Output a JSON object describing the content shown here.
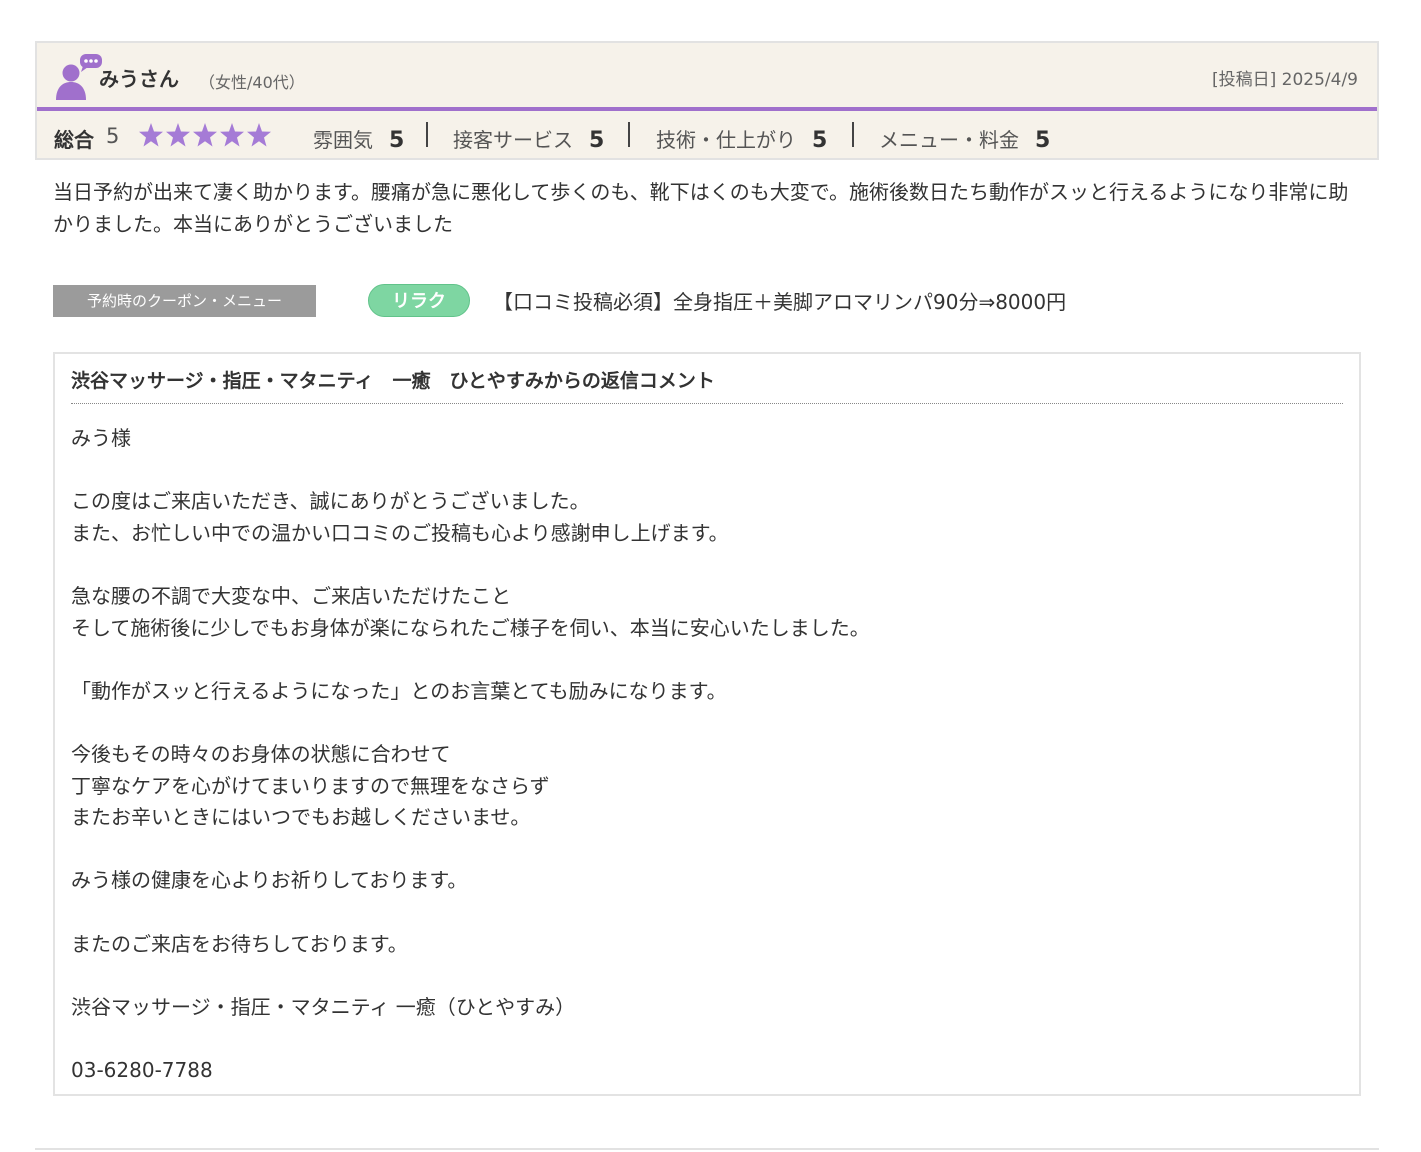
{
  "review": {
    "reviewer_name": "みうさん",
    "reviewer_attributes": "（女性/40代）",
    "post_date": "[投稿日] 2025/4/9",
    "total_label": "総合",
    "total_score": "5",
    "stars": 5,
    "ratings": [
      {
        "label": "雰囲気",
        "value": "5"
      },
      {
        "label": "接客サービス",
        "value": "5"
      },
      {
        "label": "技術・仕上がり",
        "value": "5"
      },
      {
        "label": "メニュー・料金",
        "value": "5"
      }
    ],
    "body": "当日予約が出来て凄く助かります。腰痛が急に悪化して歩くのも、靴下はくのも大変で。施術後数日たち動作がスッと行えるようになり非常に助かりました。本当にありがとうございました"
  },
  "coupon": {
    "label": "予約時のクーポン・メニュー",
    "badge": "リラク",
    "name": "【口コミ投稿必須】全身指圧＋美脚アロマリンパ90分⇒8000円"
  },
  "reply": {
    "title": "渋谷マッサージ・指圧・マタニティ　一癒　ひとやすみからの返信コメント",
    "text": "みう様\n\nこの度はご来店いただき、誠にありがとうございました。\nまた、お忙しい中での温かい口コミのご投稿も心より感謝申し上げます。\n\n急な腰の不調で大変な中、ご来店いただけたこと\nそして施術後に少しでもお身体が楽になられたご様子を伺い、本当に安心いたしました。\n\n「動作がスッと行えるようになった」とのお言葉とても励みになります。\n\n今後もその時々のお身体の状態に合わせて\n丁寧なケアを心がけてまいりますので無理をなさらず\nまたお辛いときにはいつでもお越しくださいませ。\n\nみう様の健康を心よりお祈りしております。\n\nまたのご来店をお待ちしております。\n\n渋谷マッサージ・指圧・マタニティ 一癒（ひとやすみ）\n\n03-6280-7788"
  },
  "colors": {
    "accent_purple": "#a070cc",
    "star": "#a57bd6",
    "header_bg": "#f6f2ea",
    "badge_green": "#7ed6a2"
  },
  "icons": {
    "avatar": "user-speech-avatar-icon",
    "star": "star-icon"
  }
}
